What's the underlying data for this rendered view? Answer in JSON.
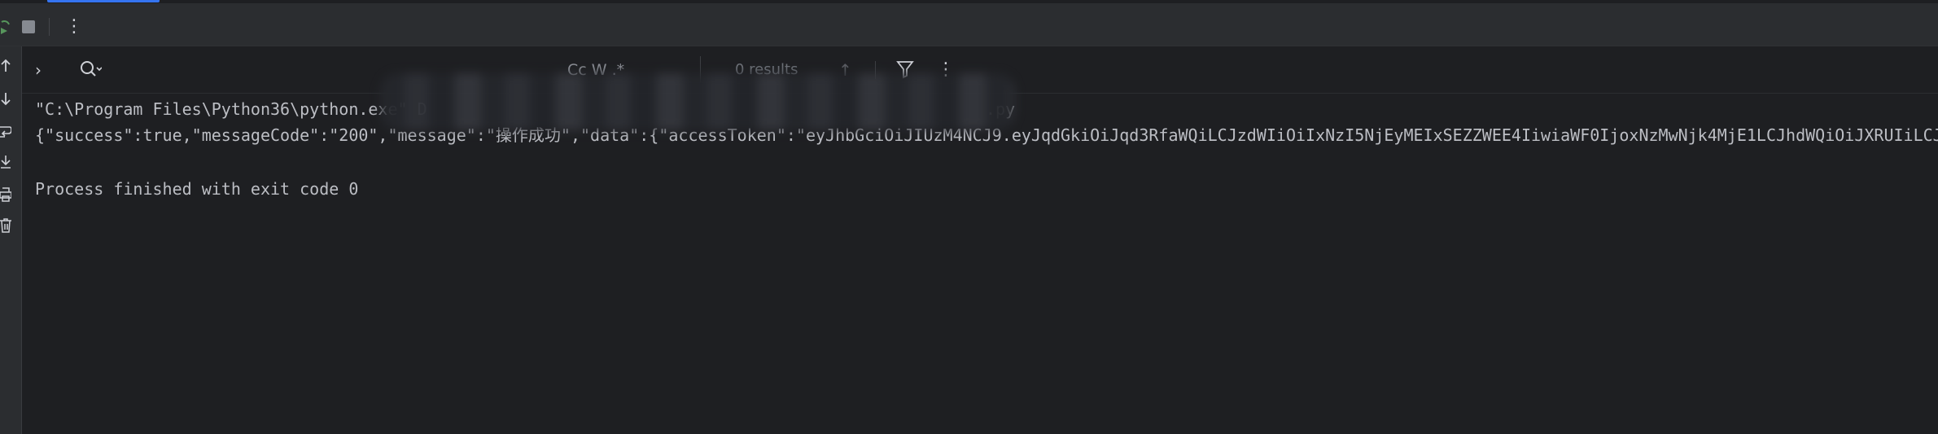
{
  "toolbar": {
    "rerun_icon": "rerun-icon",
    "stop_icon": "stop-icon",
    "more_glyph": "⋮"
  },
  "gutter": {
    "icons": [
      "arrow-up-icon",
      "arrow-down-icon",
      "soft-wrap-icon",
      "scroll-to-end-icon",
      "print-icon",
      "trash-icon"
    ]
  },
  "console_header": {
    "expand_glyph": "›",
    "search_value": "",
    "match_options": "Cc W .*",
    "results": "0 results",
    "prev_glyph": "↑",
    "more_glyph": "⋮",
    "close_glyph": "✕"
  },
  "console": {
    "lines": [
      "\"C:\\Program Files\\Python36\\python.exe\" D                                                         .py",
      "{\"success\":true,\"messageCode\":\"200\",\"message\":\"操作成功\",\"data\":{\"accessToken\":\"eyJhbGciOiJIUzM4NCJ9.eyJqdGkiOiJqd3RfaWQiLCJzdWIiOiIxNzI5NjEyMEIxSEZZWEE4IiwiaWF0IjoxNzMwNjk4MjE1LCJhdWQiOiJXRUIiLCJ",
      "Process finished with exit code 0"
    ]
  },
  "colors": {
    "background": "#1e1f22",
    "toolbar": "#2b2d30",
    "text": "#bcbec4",
    "accent": "#3574f0"
  }
}
